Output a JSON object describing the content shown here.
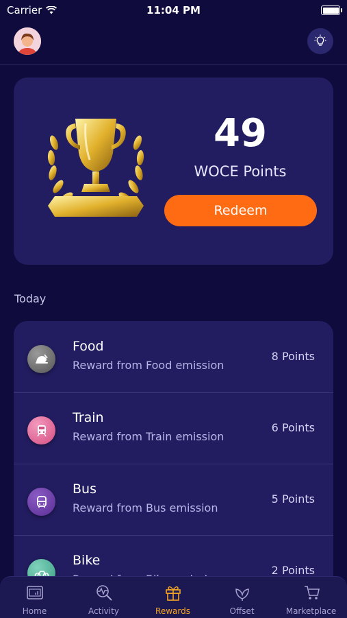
{
  "status_bar": {
    "carrier": "Carrier",
    "time": "11:04 PM"
  },
  "rewards": {
    "points": "49",
    "points_label": "WOCE Points",
    "redeem_label": "Redeem"
  },
  "section_title": "Today",
  "activities": [
    {
      "title": "Food",
      "subtitle": "Reward from Food emission",
      "points": "8 Points",
      "icon": "food-icon",
      "color": "#6b6b6b"
    },
    {
      "title": "Train",
      "subtitle": "Reward from Train emission",
      "points": "6 Points",
      "icon": "train-icon",
      "color": "#e86a9a"
    },
    {
      "title": "Bus",
      "subtitle": "Reward from Bus emission",
      "points": "5 Points",
      "icon": "bus-icon",
      "color": "#6a3ea1"
    },
    {
      "title": "Bike",
      "subtitle": "Reward from Bike emission",
      "points": "2 Points",
      "icon": "bike-icon",
      "color": "#4fb39a"
    }
  ],
  "tabs": [
    {
      "label": "Home",
      "icon": "home-icon"
    },
    {
      "label": "Activity",
      "icon": "activity-icon"
    },
    {
      "label": "Rewards",
      "icon": "gift-icon"
    },
    {
      "label": "Offset",
      "icon": "leaf-icon"
    },
    {
      "label": "Marketplace",
      "icon": "cart-icon"
    }
  ],
  "colors": {
    "background": "#0f0b3d",
    "card": "#221d60",
    "accent": "#ff6b12",
    "active_tab": "#f5a623"
  }
}
